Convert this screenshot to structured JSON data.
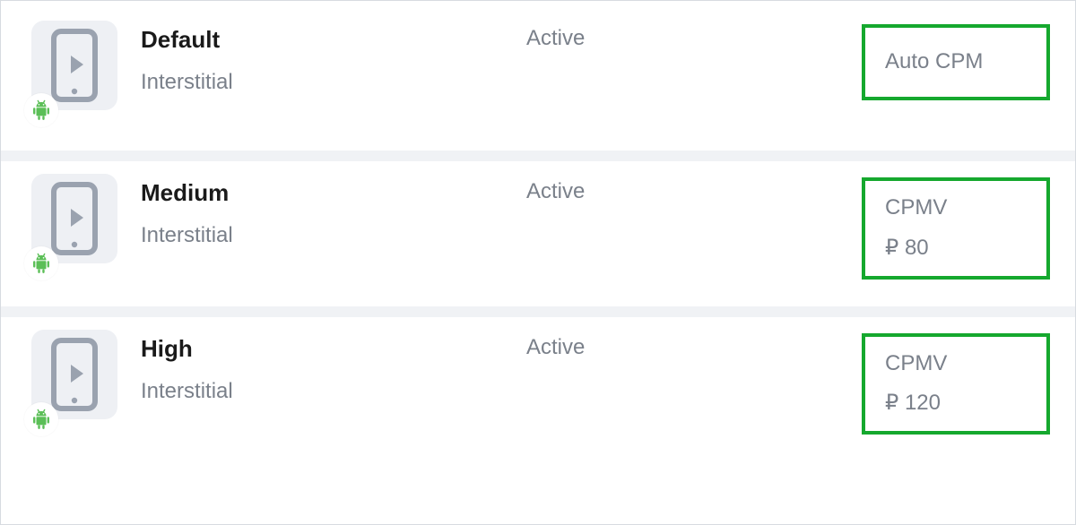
{
  "rows": [
    {
      "title": "Default",
      "subtitle": "Interstitial",
      "status": "Active",
      "price_label": "Auto CPM",
      "price_value": null,
      "os": "android"
    },
    {
      "title": "Medium",
      "subtitle": "Interstitial",
      "status": "Active",
      "price_label": "CPMV",
      "price_value": "₽ 80",
      "os": "android"
    },
    {
      "title": "High",
      "subtitle": "Interstitial",
      "status": "Active",
      "price_label": "CPMV",
      "price_value": "₽ 120",
      "os": "android"
    }
  ],
  "colors": {
    "highlight": "#15a82e",
    "muted": "#7a808a",
    "tile": "#eef0f4"
  }
}
